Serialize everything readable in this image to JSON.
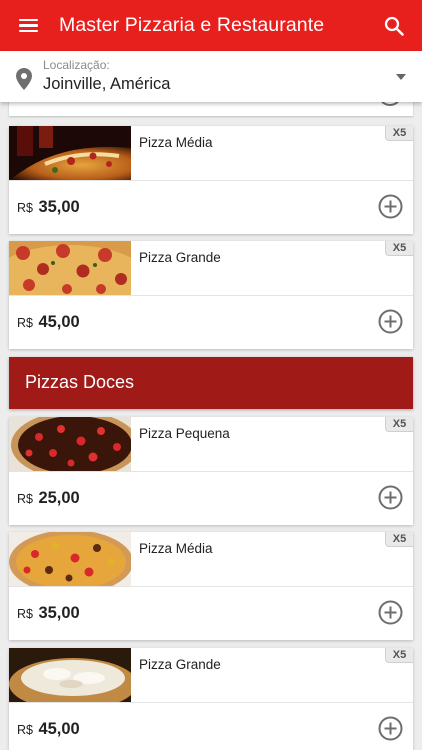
{
  "app": {
    "title": "Master Pizzaria e Restaurante"
  },
  "icons": {
    "menu": "menu-icon",
    "search": "search-icon",
    "location": "location-pin-icon",
    "dropdown": "dropdown-arrow-icon",
    "add": "add-circle-icon"
  },
  "colors": {
    "appbar": "#e8201d",
    "section_header": "#a01a18"
  },
  "location": {
    "label": "Localização:",
    "value": "Joinville, América"
  },
  "section_before": {
    "products": [
      {
        "name": "Pizza Média",
        "badge": "X5",
        "currency": "R$",
        "price": "35,00",
        "image": "savory-pizza-slice"
      },
      {
        "name": "Pizza Grande",
        "badge": "X5",
        "currency": "R$",
        "price": "45,00",
        "image": "pepperoni-pizza"
      }
    ]
  },
  "section_doces": {
    "title": "Pizzas Doces",
    "products": [
      {
        "name": "Pizza Pequena",
        "badge": "X5",
        "currency": "R$",
        "price": "25,00",
        "image": "chocolate-strawberry-pizza"
      },
      {
        "name": "Pizza Média",
        "badge": "X5",
        "currency": "R$",
        "price": "35,00",
        "image": "fruit-pizza"
      },
      {
        "name": "Pizza Grande",
        "badge": "X5",
        "currency": "R$",
        "price": "45,00",
        "image": "white-chocolate-pizza"
      }
    ]
  }
}
